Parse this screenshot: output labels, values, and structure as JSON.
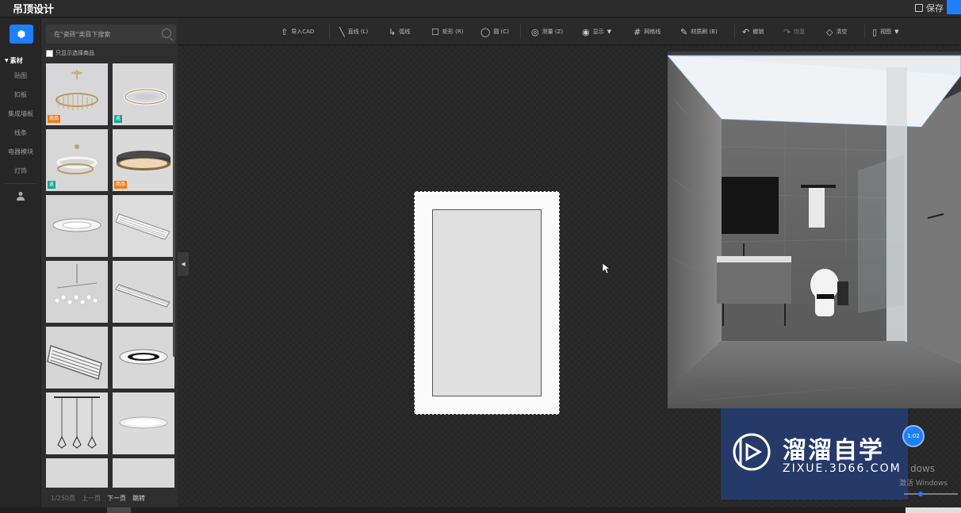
{
  "app": {
    "title": "吊顶设计",
    "save_label": "保存"
  },
  "toolbar": {
    "items": [
      {
        "icon": "upload-icon",
        "label": "导入CAD"
      },
      {
        "icon": "line-icon",
        "label": "直线 (L)"
      },
      {
        "icon": "arc-icon",
        "label": "弧线"
      },
      {
        "icon": "rectangle-icon",
        "label": "矩形 (R)"
      },
      {
        "icon": "circle-icon",
        "label": "圆 (C)"
      },
      {
        "icon": "measure-icon",
        "label": "测量 (Z)"
      },
      {
        "icon": "eye-icon",
        "label": "显示"
      },
      {
        "icon": "grid-icon",
        "label": "网格线"
      },
      {
        "icon": "material-brush-icon",
        "label": "材质刷 (B)"
      },
      {
        "icon": "undo-icon",
        "label": "撤销"
      },
      {
        "icon": "redo-icon",
        "label": "恢复"
      },
      {
        "icon": "eraser-icon",
        "label": "清空"
      },
      {
        "icon": "view-icon",
        "label": "视图"
      }
    ]
  },
  "rail": {
    "group_label": "素材",
    "items": [
      "贴图",
      "扣板",
      "集成墙板",
      "线条",
      "电器模块",
      "灯饰"
    ]
  },
  "panel": {
    "search_placeholder": "在\"瓷砖\"类目下搜索",
    "filter_label": "只显示选择商品",
    "badges": {
      "product": "商品",
      "return": "返"
    },
    "pager": {
      "page": "1/250页",
      "prev": "上一页",
      "next": "下一页",
      "jump": "跳转"
    }
  },
  "watermark": {
    "title": "溜溜自学",
    "url": "ZIXUE.3D66.COM"
  },
  "overlay": {
    "timer": "1:02",
    "windows_text": "dows",
    "activate_text": "激活 Windows"
  }
}
